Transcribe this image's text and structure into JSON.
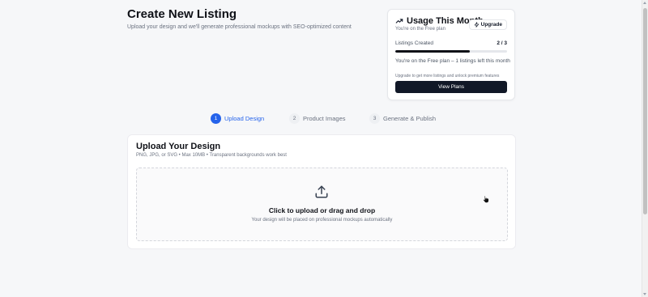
{
  "header": {
    "title": "Create New Listing",
    "subtitle": "Upload your design and we'll generate professional mockups with SEO-optimized content"
  },
  "usage": {
    "icon": "trending-up-icon",
    "title": "Usage This Month",
    "plan_text": "You're on the Free plan",
    "upgrade_label": "Upgrade",
    "upgrade_icon": "lightning-icon",
    "listings_label": "Listings Created",
    "listings_count": "2 / 3",
    "progress": 0.667,
    "remaining_text": "You're on the Free plan – 1 listings left this month",
    "upgrade_note": "Upgrade to get more listings and unlock premium features",
    "view_plans_label": "View Plans"
  },
  "steps": [
    {
      "number": "1",
      "label": "Upload Design",
      "active": true
    },
    {
      "number": "2",
      "label": "Product Images",
      "active": false
    },
    {
      "number": "3",
      "label": "Generate & Publish",
      "active": false
    }
  ],
  "upload": {
    "title": "Upload Your Design",
    "subtitle": "PNG, JPG, or SVG • Max 10MB • Transparent backgrounds work best",
    "icon": "upload-icon",
    "dropzone_title": "Click to upload or drag and drop",
    "dropzone_hint": "Your design will be placed on professional mockups automatically"
  },
  "colors": {
    "accent": "#2563eb",
    "dark": "#111827",
    "muted": "#6b7280",
    "background": "#f6f7f9"
  }
}
